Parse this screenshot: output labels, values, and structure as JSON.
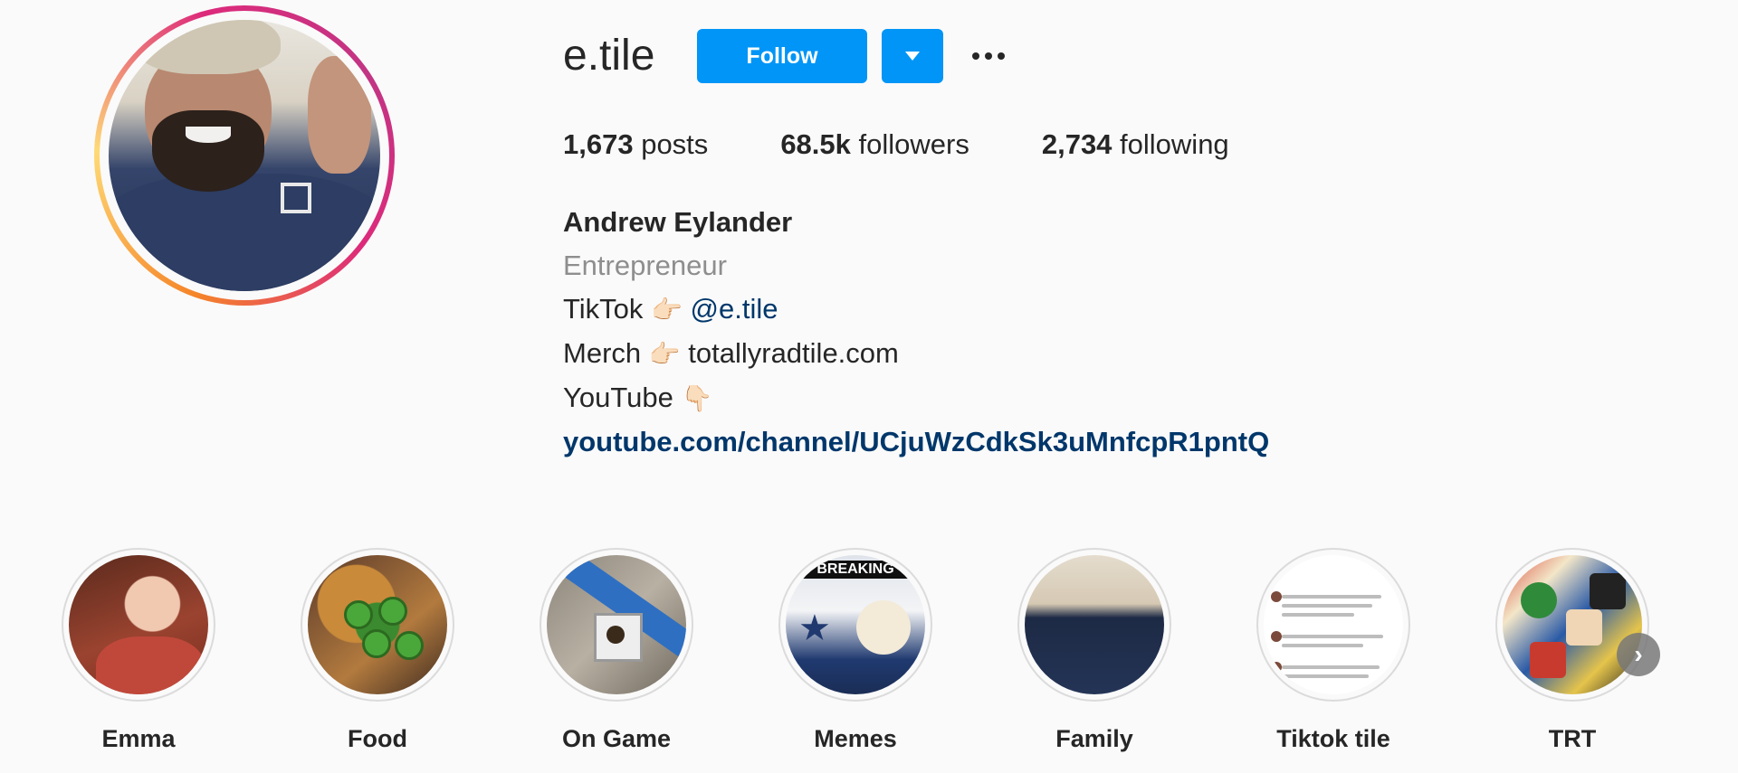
{
  "profile": {
    "username": "e.tile",
    "follow_label": "Follow",
    "stats": [
      {
        "value": "1,673",
        "label": "posts"
      },
      {
        "value": "68.5k",
        "label": "followers"
      },
      {
        "value": "2,734",
        "label": "following"
      }
    ],
    "bio": {
      "full_name": "Andrew Eylander",
      "category": "Entrepreneur",
      "tiktok_prefix": "TikTok",
      "tiktok_emoji": "👉🏻",
      "tiktok_handle": "@e.tile",
      "merch_prefix": "Merch",
      "merch_emoji": "👉🏻",
      "merch_site": "totallyradtile.com",
      "youtube_prefix": "YouTube",
      "youtube_emoji": "👇🏻",
      "external_link": "youtube.com/channel/UCjuWzCdkSk3uMnfcpR1pntQ"
    }
  },
  "highlights": [
    {
      "label": "Emma"
    },
    {
      "label": "Food"
    },
    {
      "label": "On Game"
    },
    {
      "label": "Memes"
    },
    {
      "label": "Family"
    },
    {
      "label": "Tiktok tile"
    },
    {
      "label": "TRT"
    }
  ],
  "memes_banner": "BREAKING",
  "next_arrow": "›",
  "colors": {
    "follow_button": "#0095f6",
    "link": "#00376b",
    "category": "#8e8e8e",
    "background": "#fafafa"
  },
  "icons": {
    "dropdown": "chevron-down-icon",
    "more": "more-options-icon",
    "next": "chevron-right-icon"
  }
}
